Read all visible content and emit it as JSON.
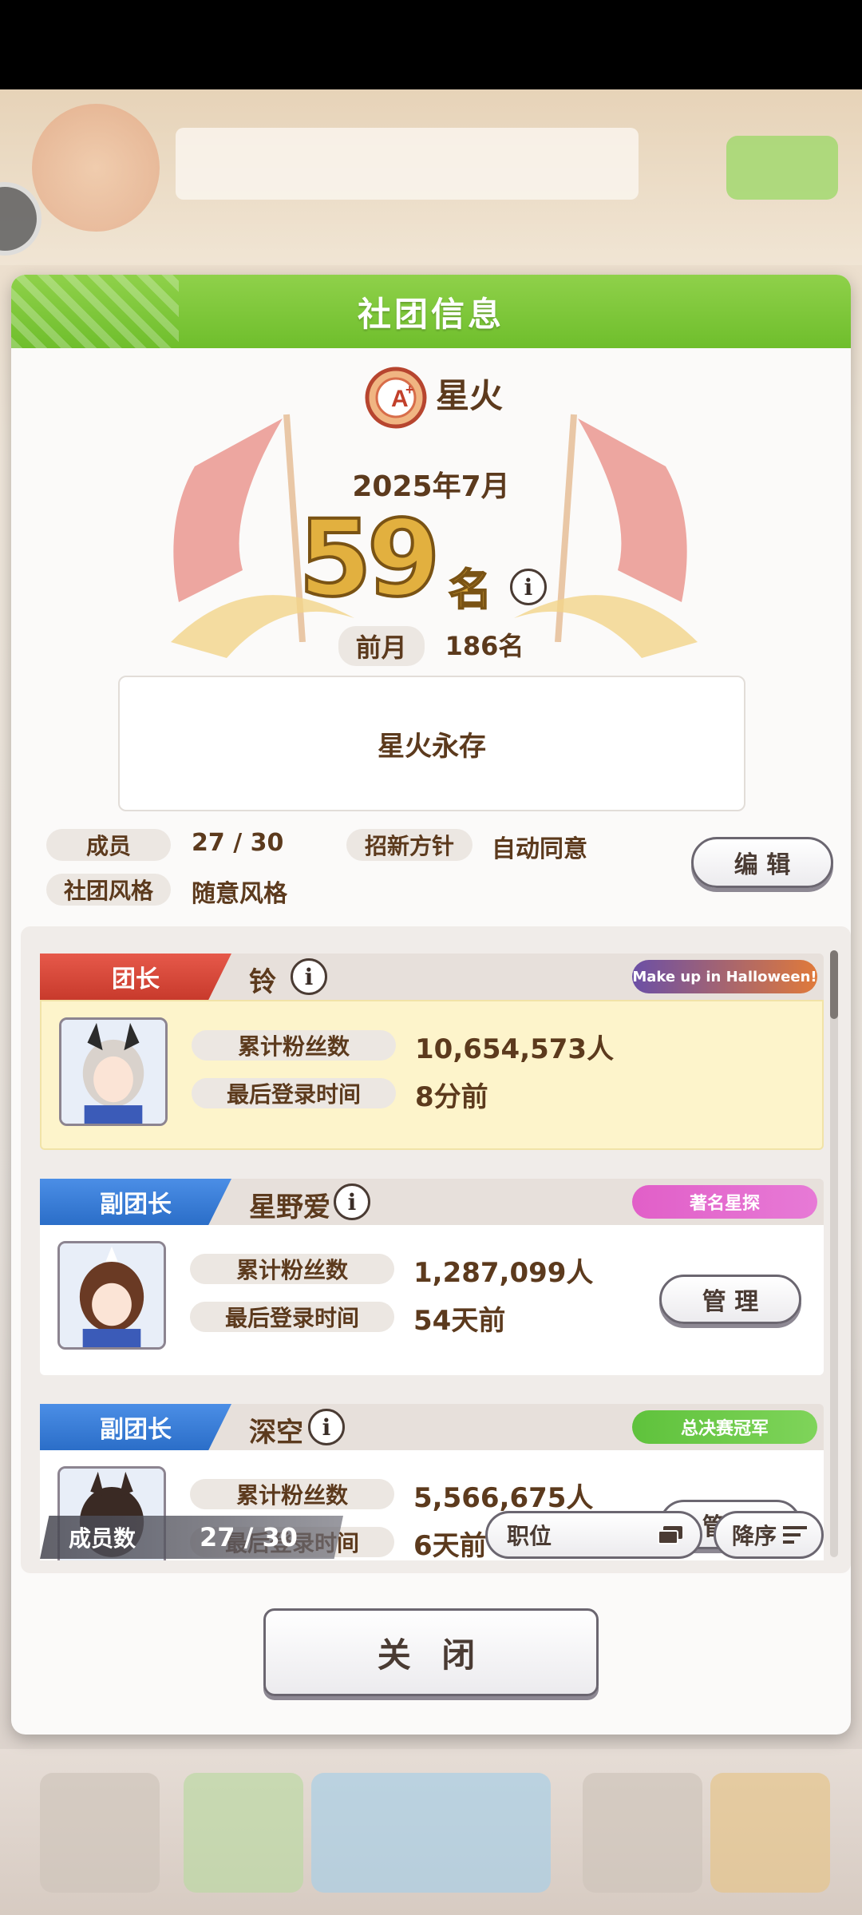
{
  "dialog": {
    "title": "社团信息"
  },
  "club": {
    "name": "星火",
    "rank_month": "2025年7月",
    "rank": "59",
    "rank_suffix": "名",
    "prev_label": "前月",
    "prev_value": "186名",
    "motto": "星火永存",
    "members_label": "成员",
    "members_value": "27 / 30",
    "recruit_label": "招新方针",
    "recruit_value": "自动同意",
    "style_label": "社团风格",
    "style_value": "随意风格",
    "edit_label": "编 辑"
  },
  "members": [
    {
      "role": "团长",
      "name": "铃",
      "badge": "Make up in Halloween!",
      "fans_label": "累计粉丝数",
      "fans": "10,654,573人",
      "login_label": "最后登录时间",
      "login": "8分前"
    },
    {
      "role": "副团长",
      "name": "星野爱",
      "badge": "著名星探",
      "fans_label": "累计粉丝数",
      "fans": "1,287,099人",
      "login_label": "最后登录时间",
      "login": "54天前",
      "manage": "管 理"
    },
    {
      "role": "副团长",
      "name": "深空",
      "badge": "总决赛冠军",
      "fans_label": "累计粉丝数",
      "fans": "5,566,675人",
      "login_label": "最后登录时间",
      "login": "6天前",
      "manage": "管 理"
    }
  ],
  "footer": {
    "count_label": "成员数",
    "count_value": "27 / 30",
    "filter_label": "职位",
    "sort_label": "降序"
  },
  "close_label": "关 闭",
  "colors": {
    "header_green": "#7ac63a",
    "leader_red": "#d8473a",
    "vice_blue": "#3a7fd8",
    "text_brown": "#5c3a1d"
  }
}
